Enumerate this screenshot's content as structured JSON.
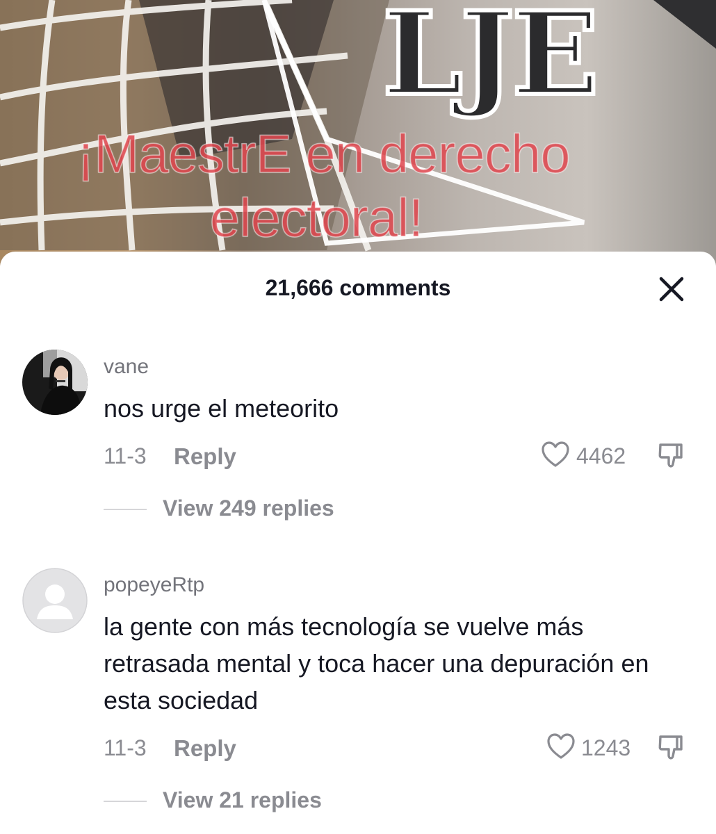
{
  "video": {
    "caption_line1": "¡MaestrE en derecho",
    "caption_line2": "electoral!",
    "sign_text": "LJE",
    "caption_color": "#e0474f"
  },
  "sheet": {
    "title": "21,666 comments",
    "close_icon": "close-icon"
  },
  "comments": [
    {
      "username": "vane",
      "text": "nos urge el meteorito",
      "date": "11-3",
      "reply_label": "Reply",
      "likes": "4462",
      "view_replies": "View 249 replies",
      "avatar": "user-photo-avatar"
    },
    {
      "username": "popeyeRtp",
      "text": "la gente con más tecnología se vuelve más retrasada mental y toca hacer una depuración en esta sociedad",
      "date": "11-3",
      "reply_label": "Reply",
      "likes": "1243",
      "view_replies": "View 21 replies",
      "avatar": "default-user-avatar"
    }
  ],
  "colors": {
    "text_primary": "#161823",
    "text_secondary": "#8a8b91"
  }
}
